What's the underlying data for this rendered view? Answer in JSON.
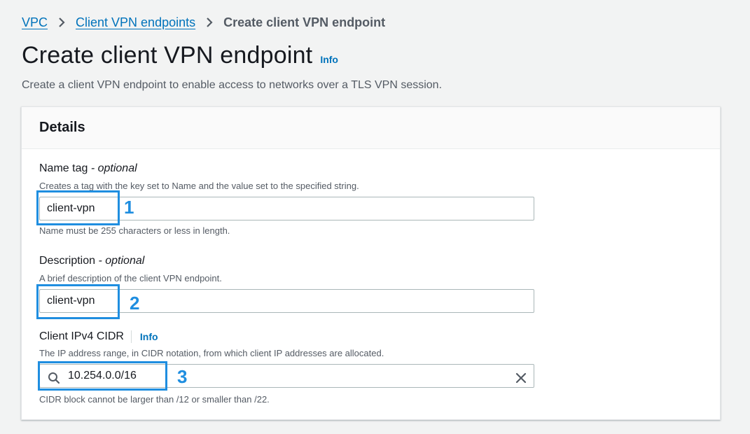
{
  "breadcrumb": {
    "items": [
      "VPC",
      "Client VPN endpoints"
    ],
    "current": "Create client VPN endpoint"
  },
  "header": {
    "title": "Create client VPN endpoint",
    "info": "Info",
    "description": "Create a client VPN endpoint to enable access to networks over a TLS VPN session."
  },
  "details": {
    "title": "Details",
    "name_tag": {
      "label": "Name tag",
      "optional": "- optional",
      "hint": "Creates a tag with the key set to Name and the value set to the specified string.",
      "value": "client-vpn",
      "constraint": "Name must be 255 characters or less in length."
    },
    "description_field": {
      "label": "Description",
      "optional": "- optional",
      "hint": "A brief description of the client VPN endpoint.",
      "value": "client-vpn"
    },
    "cidr": {
      "label": "Client IPv4 CIDR",
      "info": "Info",
      "hint": "The IP address range, in CIDR notation, from which client IP addresses are allocated.",
      "value": "10.254.0.0/16",
      "constraint": "CIDR block cannot be larger than /12 or smaller than /22."
    }
  },
  "annotations": [
    "1",
    "2",
    "3"
  ],
  "colors": {
    "link": "#0073bb",
    "highlight": "#1f8ee0",
    "background": "#f2f3f3"
  },
  "icons": {
    "breadcrumb_separator": "chevron-right-icon",
    "search": "search-icon",
    "clear": "close-icon"
  }
}
